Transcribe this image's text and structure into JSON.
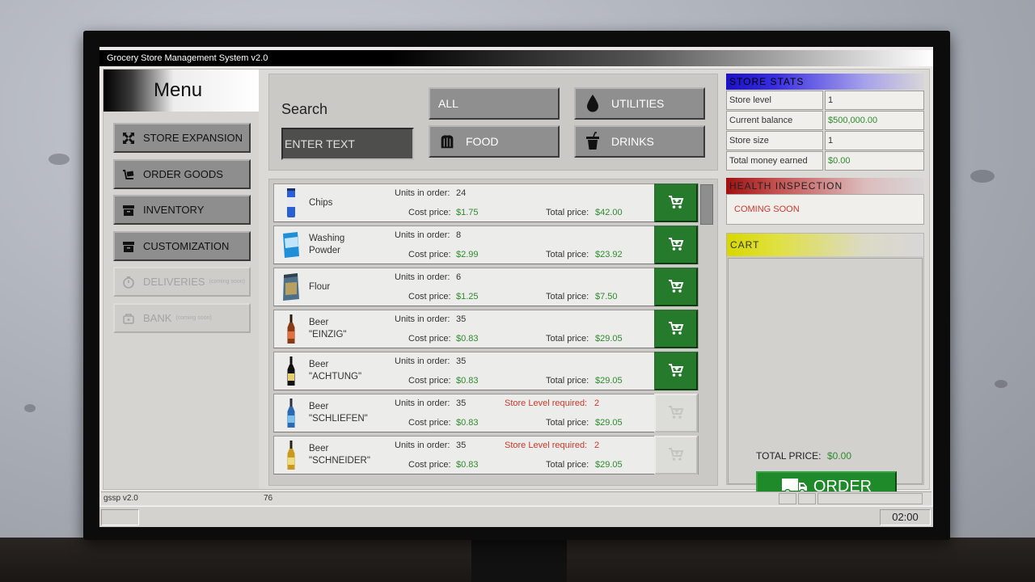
{
  "window": {
    "title": "Grocery Store Management System v2.0"
  },
  "menu": {
    "title": "Menu",
    "items": [
      {
        "label": "STORE EXPANSION",
        "icon": "expand-icon",
        "enabled": true
      },
      {
        "label": "ORDER GOODS",
        "icon": "order-goods-icon",
        "enabled": true
      },
      {
        "label": "INVENTORY",
        "icon": "inventory-box-icon",
        "enabled": true
      },
      {
        "label": "CUSTOMIZATION",
        "icon": "customization-box-icon",
        "enabled": true
      },
      {
        "label": "DELIVERIES",
        "note": "(coming soon)",
        "icon": "timer-icon",
        "enabled": false
      },
      {
        "label": "BANK",
        "note": "(coming soon)",
        "icon": "bank-icon",
        "enabled": false
      }
    ]
  },
  "search": {
    "label": "Search",
    "placeholder": "ENTER TEXT",
    "categories": [
      {
        "label": "ALL",
        "icon": ""
      },
      {
        "label": "UTILITIES",
        "icon": "droplet-icon"
      },
      {
        "label": "FOOD",
        "icon": "bread-icon"
      },
      {
        "label": "DRINKS",
        "icon": "cup-icon"
      }
    ]
  },
  "products": {
    "units_label": "Units in order:",
    "cost_label": "Cost price:",
    "total_label": "Total price:",
    "level_label": "Store Level required:",
    "items": [
      {
        "name": "Chips",
        "units": "24",
        "cost": "$1.75",
        "total": "$42.00",
        "available": true,
        "thumb": "chips-can-icon"
      },
      {
        "name": "Washing Powder",
        "units": "8",
        "cost": "$2.99",
        "total": "$23.92",
        "available": true,
        "thumb": "washing-powder-icon"
      },
      {
        "name": "Flour",
        "units": "6",
        "cost": "$1.25",
        "total": "$7.50",
        "available": true,
        "thumb": "flour-bag-icon"
      },
      {
        "name": "Beer \"EINZIG\"",
        "units": "35",
        "cost": "$0.83",
        "total": "$29.05",
        "available": true,
        "thumb": "beer-bottle-red-icon"
      },
      {
        "name": "Beer \"ACHTUNG\"",
        "units": "35",
        "cost": "$0.83",
        "total": "$29.05",
        "available": true,
        "thumb": "beer-bottle-yellow-icon"
      },
      {
        "name": "Beer \"SCHLIEFEN\"",
        "units": "35",
        "cost": "$0.83",
        "total": "$29.05",
        "available": false,
        "level": "2",
        "thumb": "beer-bottle-blue-icon"
      },
      {
        "name": "Beer \"SCHNEIDER\"",
        "units": "35",
        "cost": "$0.83",
        "total": "$29.05",
        "available": false,
        "level": "2",
        "thumb": "beer-bottle-gold-icon"
      }
    ]
  },
  "store_stats": {
    "title": "STORE STATS",
    "rows": [
      {
        "label": "Store level",
        "value": "1"
      },
      {
        "label": "Current balance",
        "value": "$500,000.00"
      },
      {
        "label": "Store size",
        "value": "1"
      },
      {
        "label": "Total money earned",
        "value": "$0.00"
      }
    ]
  },
  "health_inspection": {
    "title": "HEALTH INSPECTION",
    "status": "COMING SOON"
  },
  "cart": {
    "title": "CART",
    "total_label": "TOTAL PRICE:",
    "total_value": "$0.00",
    "order_label": "ORDER"
  },
  "statusbar": {
    "left": "gssp v2.0",
    "mid": "76"
  },
  "taskbar": {
    "clock": "02:00"
  },
  "colors": {
    "accent_green": "#257a2c",
    "price_green": "#2e8a2e",
    "warning_red": "#c83a2c"
  }
}
